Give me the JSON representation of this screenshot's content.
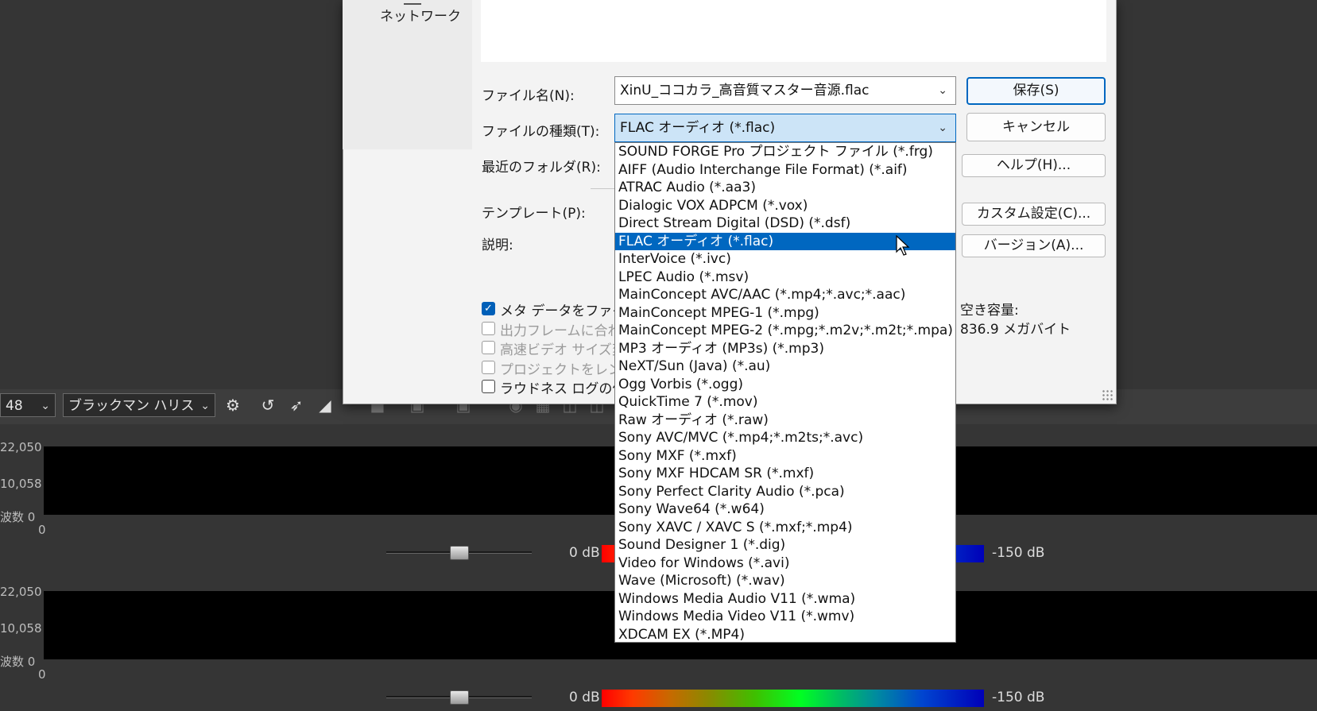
{
  "daw": {
    "sample_rate_select": "48",
    "window_select": "ブラックマン ハリス",
    "lane1": {
      "tick_high": "22,050",
      "tick_mid": "10,058",
      "tick_low": "波数 0",
      "tick_zero": "0",
      "db_left": "0 dB",
      "db_right": "-150 dB"
    },
    "lane2": {
      "tick_high": "22,050",
      "tick_mid": "10,058",
      "tick_low": "波数 0",
      "tick_zero": "0",
      "db_left": "0 dB",
      "db_right": "-150 dB"
    }
  },
  "dialog": {
    "nav_network": "ネットワーク",
    "filename_label": "ファイル名(N):",
    "filename_value": "XinU_ココカラ_高音質マスター音源.flac",
    "filetype_label": "ファイルの種類(T):",
    "filetype_value": "FLAC オーディオ (*.flac)",
    "recent_label": "最近のフォルダ(R):",
    "template_label": "テンプレート(P):",
    "description_label": "説明:",
    "buttons": {
      "save": "保存(S)",
      "cancel": "キャンセル",
      "help": "ヘルプ(H)...",
      "custom": "カスタム設定(C)...",
      "version": "バージョン(A)..."
    },
    "checkboxes": [
      {
        "label": "メタ データをファイルと",
        "checked": true,
        "enabled": true
      },
      {
        "label": "出力フレームに合わせ",
        "checked": false,
        "enabled": false
      },
      {
        "label": "高速ビデオ サイズ変",
        "checked": false,
        "enabled": false
      },
      {
        "label": "プロジェクトをレンダリ",
        "checked": false,
        "enabled": false
      },
      {
        "label": "ラウドネス ログの作成",
        "checked": false,
        "enabled": true
      }
    ],
    "free_space_label": "空き容量:",
    "free_space_value": "836.9 メガバイト"
  },
  "dropdown": {
    "selected_index": 5,
    "items": [
      "SOUND FORGE Pro プロジェクト ファイル (*.frg)",
      "AIFF (Audio Interchange File Format) (*.aif)",
      "ATRAC Audio (*.aa3)",
      "Dialogic VOX ADPCM (*.vox)",
      "Direct Stream Digital (DSD) (*.dsf)",
      "FLAC オーディオ (*.flac)",
      "InterVoice (*.ivc)",
      "LPEC Audio (*.msv)",
      "MainConcept AVC/AAC (*.mp4;*.avc;*.aac)",
      "MainConcept MPEG-1 (*.mpg)",
      "MainConcept MPEG-2 (*.mpg;*.m2v;*.m2t;*.mpa)",
      "MP3 オーディオ (MP3s) (*.mp3)",
      "NeXT/Sun (Java) (*.au)",
      "Ogg Vorbis (*.ogg)",
      "QuickTime 7 (*.mov)",
      "Raw オーディオ (*.raw)",
      "Sony AVC/MVC (*.mp4;*.m2ts;*.avc)",
      "Sony MXF (*.mxf)",
      "Sony MXF HDCAM SR (*.mxf)",
      "Sony Perfect Clarity Audio (*.pca)",
      "Sony Wave64 (*.w64)",
      "Sony XAVC / XAVC S (*.mxf;*.mp4)",
      "Sound Designer 1 (*.dig)",
      "Video for Windows (*.avi)",
      "Wave (Microsoft) (*.wav)",
      "Windows Media Audio V11 (*.wma)",
      "Windows Media Video V11 (*.wmv)",
      "XDCAM EX (*.MP4)"
    ]
  },
  "colors": {
    "accent": "#0067c0",
    "selection": "#0067c0",
    "checkbox": "#005fb8"
  },
  "icons": [
    "settings-gear-icon",
    "undo-icon",
    "cursor-arrow-icon",
    "speaker-icon",
    "chevron-down-icon"
  ]
}
